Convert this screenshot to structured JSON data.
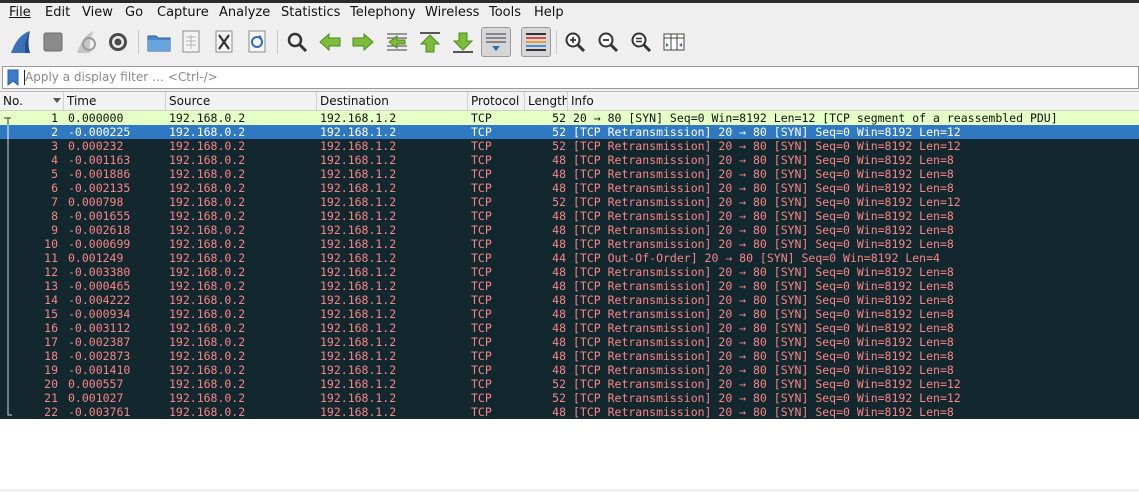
{
  "menu": [
    "File",
    "Edit",
    "View",
    "Go",
    "Capture",
    "Analyze",
    "Statistics",
    "Telephony",
    "Wireless",
    "Tools",
    "Help"
  ],
  "menu_underline_index": [
    0,
    0,
    0,
    0,
    0,
    0,
    -1,
    -1,
    0,
    0,
    0
  ],
  "filter": {
    "placeholder": "Apply a display filter … <Ctrl-/>",
    "value": ""
  },
  "columns": {
    "no": "No.",
    "time": "Time",
    "source": "Source",
    "destination": "Destination",
    "protocol": "Protocol",
    "length": "Length",
    "info": "Info"
  },
  "colors": {
    "first_row_bg": "#e5ffc6",
    "first_row_fg": "#121212",
    "selected_bg": "#2f79c2",
    "selected_fg": "#ffffff",
    "bad_bg": "#12272e",
    "bad_fg": "#f78787"
  },
  "packets": [
    {
      "no": "1",
      "time": "0.000000",
      "source": "192.168.0.2",
      "destination": "192.168.1.2",
      "protocol": "TCP",
      "length": "52",
      "info": "20 → 80 [SYN] Seq=0 Win=8192 Len=12 [TCP segment of a reassembled PDU]",
      "style": "first"
    },
    {
      "no": "2",
      "time": "-0.000225",
      "source": "192.168.0.2",
      "destination": "192.168.1.2",
      "protocol": "TCP",
      "length": "52",
      "info": "[TCP Retransmission] 20 → 80 [SYN] Seq=0 Win=8192 Len=12",
      "style": "selected"
    },
    {
      "no": "3",
      "time": "0.000232",
      "source": "192.168.0.2",
      "destination": "192.168.1.2",
      "protocol": "TCP",
      "length": "52",
      "info": "[TCP Retransmission] 20 → 80 [SYN] Seq=0 Win=8192 Len=12",
      "style": "bad"
    },
    {
      "no": "4",
      "time": "-0.001163",
      "source": "192.168.0.2",
      "destination": "192.168.1.2",
      "protocol": "TCP",
      "length": "48",
      "info": "[TCP Retransmission] 20 → 80 [SYN] Seq=0 Win=8192 Len=8",
      "style": "bad"
    },
    {
      "no": "5",
      "time": "-0.001886",
      "source": "192.168.0.2",
      "destination": "192.168.1.2",
      "protocol": "TCP",
      "length": "48",
      "info": "[TCP Retransmission] 20 → 80 [SYN] Seq=0 Win=8192 Len=8",
      "style": "bad"
    },
    {
      "no": "6",
      "time": "-0.002135",
      "source": "192.168.0.2",
      "destination": "192.168.1.2",
      "protocol": "TCP",
      "length": "48",
      "info": "[TCP Retransmission] 20 → 80 [SYN] Seq=0 Win=8192 Len=8",
      "style": "bad"
    },
    {
      "no": "7",
      "time": "0.000798",
      "source": "192.168.0.2",
      "destination": "192.168.1.2",
      "protocol": "TCP",
      "length": "52",
      "info": "[TCP Retransmission] 20 → 80 [SYN] Seq=0 Win=8192 Len=12",
      "style": "bad"
    },
    {
      "no": "8",
      "time": "-0.001655",
      "source": "192.168.0.2",
      "destination": "192.168.1.2",
      "protocol": "TCP",
      "length": "48",
      "info": "[TCP Retransmission] 20 → 80 [SYN] Seq=0 Win=8192 Len=8",
      "style": "bad"
    },
    {
      "no": "9",
      "time": "-0.002618",
      "source": "192.168.0.2",
      "destination": "192.168.1.2",
      "protocol": "TCP",
      "length": "48",
      "info": "[TCP Retransmission] 20 → 80 [SYN] Seq=0 Win=8192 Len=8",
      "style": "bad"
    },
    {
      "no": "10",
      "time": "-0.000699",
      "source": "192.168.0.2",
      "destination": "192.168.1.2",
      "protocol": "TCP",
      "length": "48",
      "info": "[TCP Retransmission] 20 → 80 [SYN] Seq=0 Win=8192 Len=8",
      "style": "bad"
    },
    {
      "no": "11",
      "time": "0.001249",
      "source": "192.168.0.2",
      "destination": "192.168.1.2",
      "protocol": "TCP",
      "length": "44",
      "info": "[TCP Out-Of-Order] 20 → 80 [SYN] Seq=0 Win=8192 Len=4",
      "style": "bad"
    },
    {
      "no": "12",
      "time": "-0.003380",
      "source": "192.168.0.2",
      "destination": "192.168.1.2",
      "protocol": "TCP",
      "length": "48",
      "info": "[TCP Retransmission] 20 → 80 [SYN] Seq=0 Win=8192 Len=8",
      "style": "bad"
    },
    {
      "no": "13",
      "time": "-0.000465",
      "source": "192.168.0.2",
      "destination": "192.168.1.2",
      "protocol": "TCP",
      "length": "48",
      "info": "[TCP Retransmission] 20 → 80 [SYN] Seq=0 Win=8192 Len=8",
      "style": "bad"
    },
    {
      "no": "14",
      "time": "-0.004222",
      "source": "192.168.0.2",
      "destination": "192.168.1.2",
      "protocol": "TCP",
      "length": "48",
      "info": "[TCP Retransmission] 20 → 80 [SYN] Seq=0 Win=8192 Len=8",
      "style": "bad"
    },
    {
      "no": "15",
      "time": "-0.000934",
      "source": "192.168.0.2",
      "destination": "192.168.1.2",
      "protocol": "TCP",
      "length": "48",
      "info": "[TCP Retransmission] 20 → 80 [SYN] Seq=0 Win=8192 Len=8",
      "style": "bad"
    },
    {
      "no": "16",
      "time": "-0.003112",
      "source": "192.168.0.2",
      "destination": "192.168.1.2",
      "protocol": "TCP",
      "length": "48",
      "info": "[TCP Retransmission] 20 → 80 [SYN] Seq=0 Win=8192 Len=8",
      "style": "bad"
    },
    {
      "no": "17",
      "time": "-0.002387",
      "source": "192.168.0.2",
      "destination": "192.168.1.2",
      "protocol": "TCP",
      "length": "48",
      "info": "[TCP Retransmission] 20 → 80 [SYN] Seq=0 Win=8192 Len=8",
      "style": "bad"
    },
    {
      "no": "18",
      "time": "-0.002873",
      "source": "192.168.0.2",
      "destination": "192.168.1.2",
      "protocol": "TCP",
      "length": "48",
      "info": "[TCP Retransmission] 20 → 80 [SYN] Seq=0 Win=8192 Len=8",
      "style": "bad"
    },
    {
      "no": "19",
      "time": "-0.001410",
      "source": "192.168.0.2",
      "destination": "192.168.1.2",
      "protocol": "TCP",
      "length": "48",
      "info": "[TCP Retransmission] 20 → 80 [SYN] Seq=0 Win=8192 Len=8",
      "style": "bad"
    },
    {
      "no": "20",
      "time": "0.000557",
      "source": "192.168.0.2",
      "destination": "192.168.1.2",
      "protocol": "TCP",
      "length": "52",
      "info": "[TCP Retransmission] 20 → 80 [SYN] Seq=0 Win=8192 Len=12",
      "style": "bad"
    },
    {
      "no": "21",
      "time": "0.001027",
      "source": "192.168.0.2",
      "destination": "192.168.1.2",
      "protocol": "TCP",
      "length": "52",
      "info": "[TCP Retransmission] 20 → 80 [SYN] Seq=0 Win=8192 Len=12",
      "style": "bad"
    },
    {
      "no": "22",
      "time": "-0.003761",
      "source": "192.168.0.2",
      "destination": "192.168.1.2",
      "protocol": "TCP",
      "length": "48",
      "info": "[TCP Retransmission] 20 → 80 [SYN] Seq=0 Win=8192 Len=8",
      "style": "bad"
    }
  ]
}
